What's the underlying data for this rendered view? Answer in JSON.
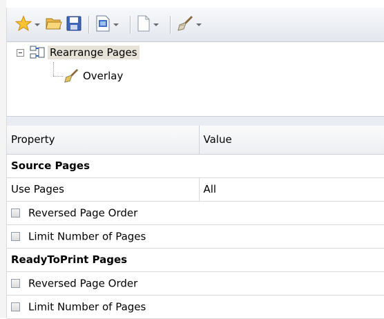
{
  "toolbar": {
    "buttons": [
      {
        "icon": "star-icon",
        "dropdown": true
      },
      {
        "icon": "open-folder-icon",
        "dropdown": false
      },
      {
        "icon": "save-icon",
        "dropdown": false
      },
      {
        "icon": "document-blue-icon",
        "dropdown": true
      },
      {
        "icon": "document-blank-icon",
        "dropdown": true
      },
      {
        "icon": "paint-brush-icon",
        "dropdown": true
      }
    ]
  },
  "tree": {
    "root": {
      "label": "Rearrange Pages",
      "icon": "rearrange-pages-icon",
      "expanded": true,
      "selected": true
    },
    "child": {
      "label": "Overlay",
      "icon": "paint-brush-icon"
    }
  },
  "grid": {
    "columns": {
      "property": "Property",
      "value": "Value"
    },
    "sections": [
      {
        "title": "Source Pages",
        "rows": [
          {
            "name": "Use Pages",
            "value": "All",
            "type": "text"
          },
          {
            "name": "Reversed Page Order",
            "value": "",
            "type": "checkbox",
            "checked": false
          },
          {
            "name": "Limit Number of Pages",
            "value": "",
            "type": "checkbox",
            "checked": false
          }
        ]
      },
      {
        "title": "ReadyToPrint Pages",
        "rows": [
          {
            "name": "Reversed Page Order",
            "value": "",
            "type": "checkbox",
            "checked": false
          },
          {
            "name": "Limit Number of Pages",
            "value": "",
            "type": "checkbox",
            "checked": false
          }
        ]
      }
    ]
  }
}
